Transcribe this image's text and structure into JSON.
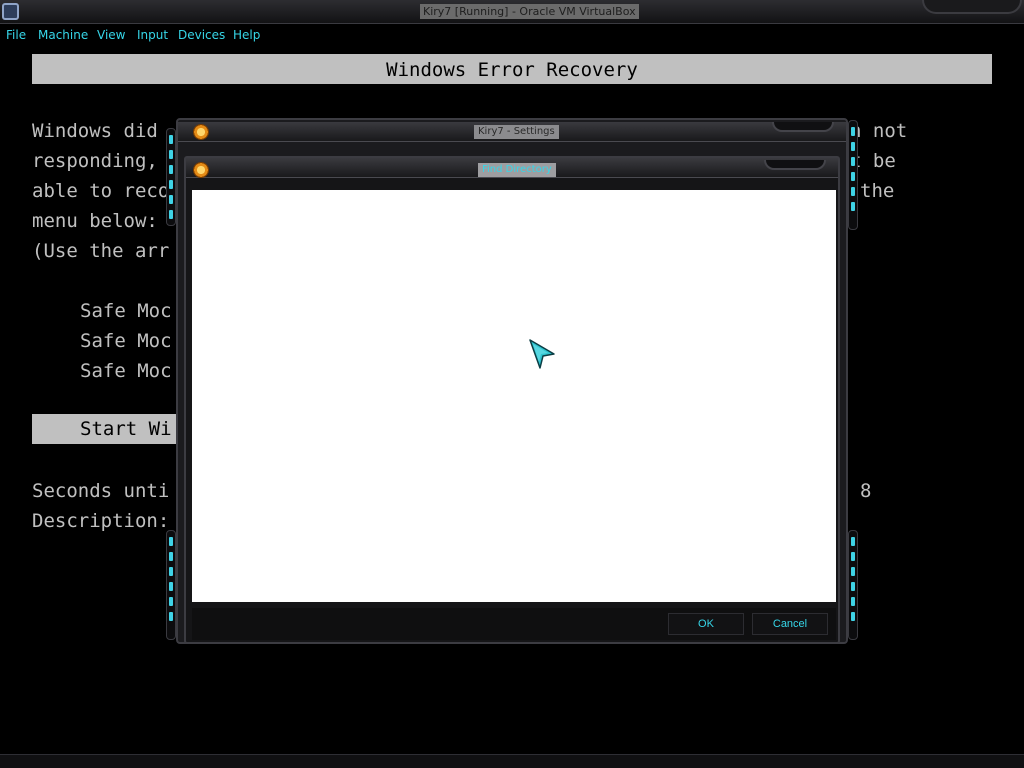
{
  "window": {
    "title": "Kiry7 [Running] - Oracle VM VirtualBox"
  },
  "menu": {
    "items": [
      "File",
      "Machine",
      "View",
      "Input",
      "Devices",
      "Help"
    ]
  },
  "recovery": {
    "title": "Windows Error Recovery",
    "line1_left": "Windows did",
    "line1_right": "n not",
    "line2_left": "responding,",
    "line2_right": "t be",
    "line3_left": "able to reco",
    "line3_right": "the",
    "line4_left": "menu below:",
    "line5_left": "(Use the arr",
    "option1": "Safe Moc",
    "option2": "Safe Moc",
    "option3": "Safe Moc",
    "selected_option": "Start Wi",
    "countdown_label": "Seconds unti",
    "countdown_value": "8",
    "description_label": "Description:"
  },
  "settings_dialog": {
    "title": "Kiry7 - Settings"
  },
  "find_dialog": {
    "title": "Find Directory",
    "ok_label": "OK",
    "cancel_label": "Cancel"
  },
  "colors": {
    "accent": "#36d6e8",
    "frame": "#1b1b1e",
    "recovery_text": "#c0c0c0"
  },
  "icons": {
    "app_icon": "virtualbox-logo-icon",
    "dialog_icon": "sun-icon",
    "cursor": "arrow-cursor-icon"
  }
}
